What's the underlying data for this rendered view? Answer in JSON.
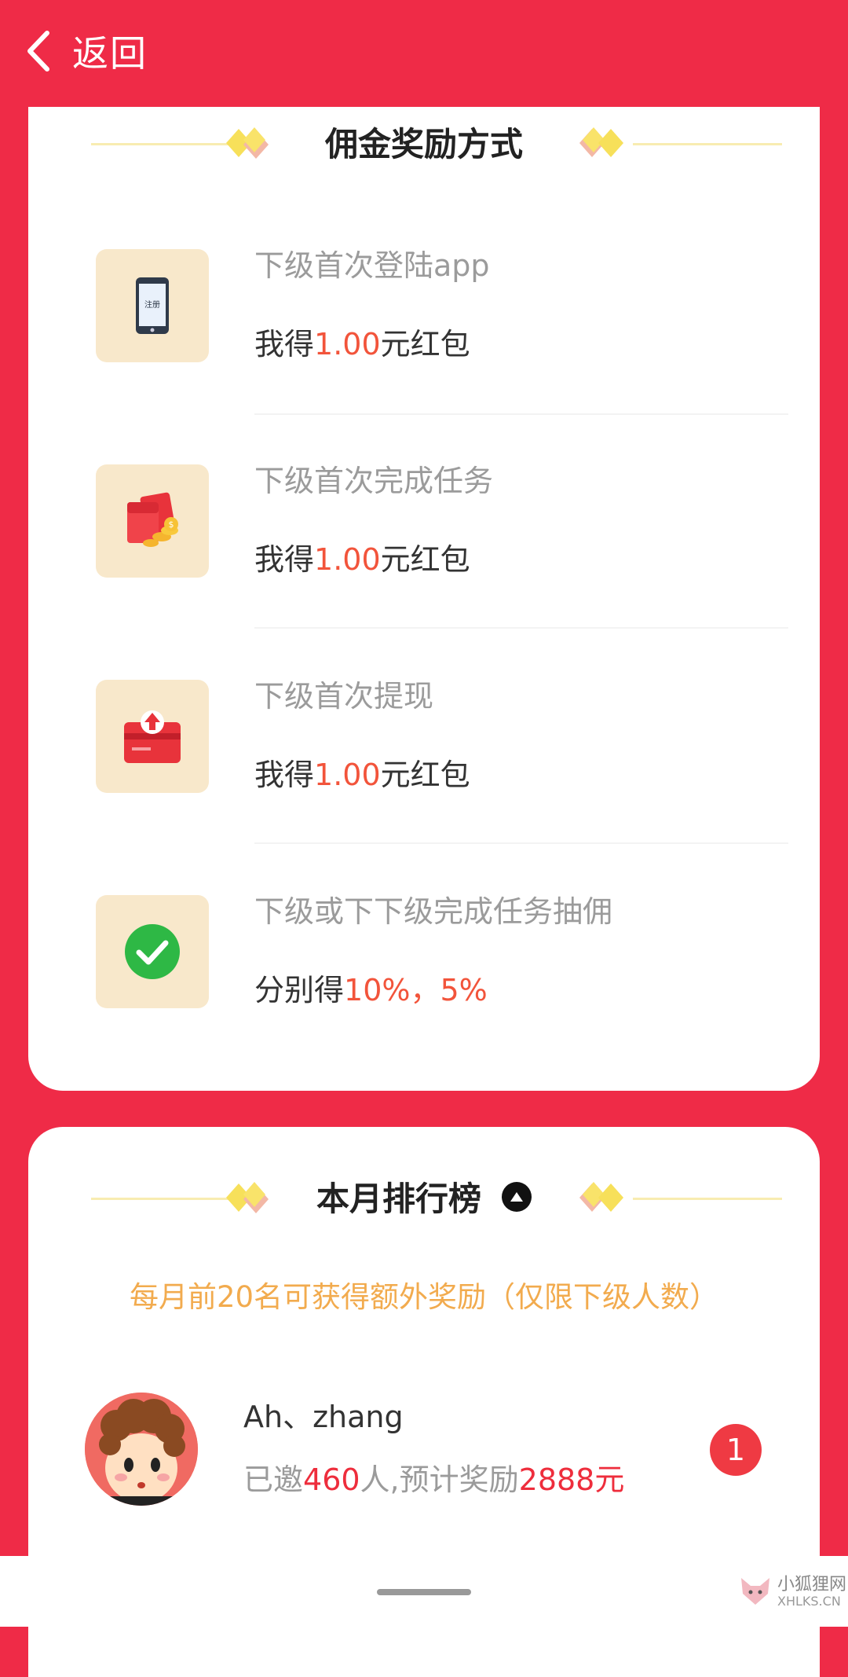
{
  "header": {
    "back_label": "返回"
  },
  "commission": {
    "title": "佣金奖励方式",
    "items": [
      {
        "icon": "phone-register-icon",
        "icon_label": "注册",
        "line1": "下级首次登陆app",
        "prefix": "我得",
        "amount": "1.00",
        "suffix": "元红包"
      },
      {
        "icon": "red-envelope-icon",
        "line1": "下级首次完成任务",
        "prefix": "我得",
        "amount": "1.00",
        "suffix": "元红包"
      },
      {
        "icon": "withdraw-card-icon",
        "line1": "下级首次提现",
        "prefix": "我得",
        "amount": "1.00",
        "suffix": "元红包"
      },
      {
        "icon": "check-circle-icon",
        "line1": "下级或下下级完成任务抽佣",
        "prefix": "分别得",
        "amount": "10%，5%",
        "suffix": ""
      }
    ]
  },
  "ranking": {
    "title": "本月排行榜",
    "note": "每月前20名可获得额外奖励（仅限下级人数）",
    "entries": [
      {
        "name": "Ah、zhang",
        "invited_prefix": "已邀",
        "invited": "460",
        "invited_mid": "人,预计奖励",
        "reward": "2888元",
        "rank": "1"
      }
    ]
  },
  "watermark": {
    "cn": "小狐狸网",
    "en": "XHLKS.CN"
  },
  "colors": {
    "accent_red": "#ef2b47",
    "highlight_orange": "#f2543b",
    "note_orange": "#f2ab4e",
    "icon_bg": "#f8e8cb"
  }
}
